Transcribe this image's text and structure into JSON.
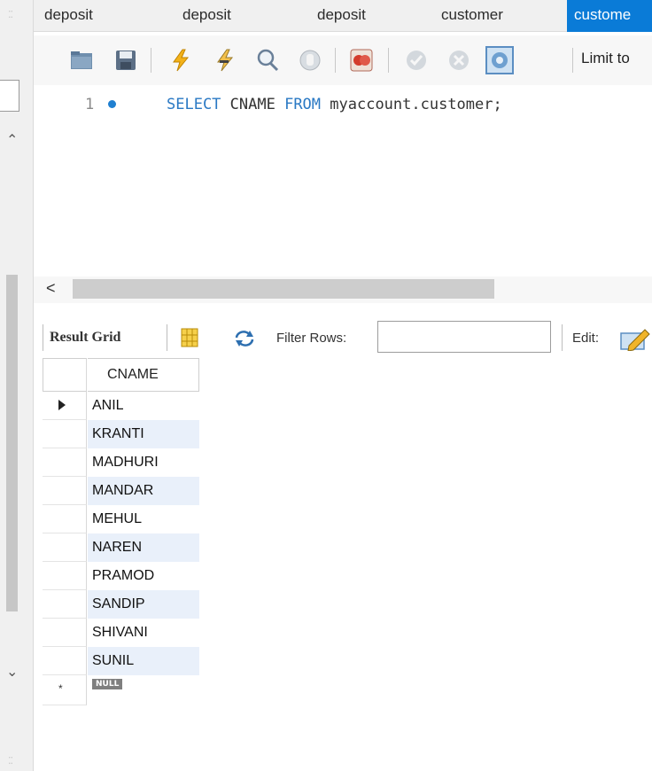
{
  "tabs": [
    "deposit",
    "deposit",
    "deposit",
    "customer",
    "custome"
  ],
  "toolbar": {
    "icons": [
      "open-folder-icon",
      "save-icon",
      "execute-icon",
      "execute-current-icon",
      "explain-icon",
      "stop-icon",
      "toggle-continue-on-error-icon",
      "commit-icon",
      "rollback-icon",
      "autocommit-icon"
    ],
    "limit_label": "Limit to"
  },
  "editor": {
    "line_number": "1",
    "keyword_select": "SELECT",
    "column": " CNAME ",
    "keyword_from": "FROM",
    "table": " myaccount.customer;"
  },
  "scroll": {
    "left_arrow": "<"
  },
  "result_toolbar": {
    "result_grid_label": "Result Grid",
    "filter_label": "Filter Rows:",
    "filter_value": "",
    "edit_label": "Edit:"
  },
  "grid": {
    "column": "CNAME",
    "rows": [
      "ANIL",
      "KRANTI",
      "MADHURI",
      "MANDAR",
      "MEHUL",
      "NAREN",
      "PRAMOD",
      "SANDIP",
      "SHIVANI",
      "SUNIL"
    ],
    "new_row_value": "NULL",
    "new_row_marker": "*"
  },
  "colors": {
    "active_tab": "#0a7bd7",
    "keyword": "#2a79c4",
    "alt_row": "#e9f0fa"
  }
}
